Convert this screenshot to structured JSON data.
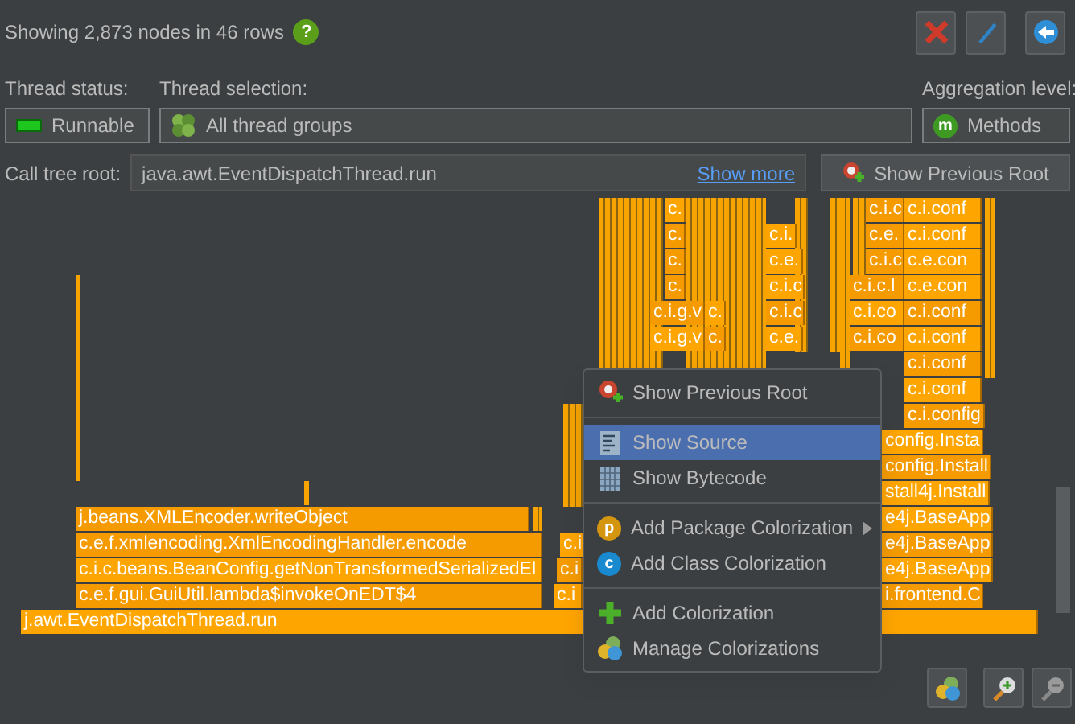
{
  "header": {
    "summary": "Showing 2,873 nodes in 46 rows",
    "help": "?"
  },
  "thread_status": {
    "label": "Thread status:",
    "value": "Runnable"
  },
  "thread_selection": {
    "label": "Thread selection:",
    "value": "All thread groups"
  },
  "aggregation_level": {
    "label": "Aggregation level:",
    "value": "Methods",
    "badge": "m"
  },
  "call_tree_root": {
    "label": "Call tree root:",
    "value": "java.awt.EventDispatchThread.run",
    "link": "Show more",
    "button": "Show Previous Root"
  },
  "flame_graph": {
    "frames": [
      {
        "label": "c."
      },
      {
        "label": "c.i.c"
      },
      {
        "label": "c.i.conf"
      },
      {
        "label": "c."
      },
      {
        "label": "c.i."
      },
      {
        "label": "c.e."
      },
      {
        "label": "c.i.conf"
      },
      {
        "label": "c."
      },
      {
        "label": "c.e."
      },
      {
        "label": "c.i.c"
      },
      {
        "label": "c.e.con"
      },
      {
        "label": "c."
      },
      {
        "label": "c.i.c"
      },
      {
        "label": "c.i.c.l"
      },
      {
        "label": "c.e.con"
      },
      {
        "label": "c.i.g.v"
      },
      {
        "label": "c."
      },
      {
        "label": "c.i.c"
      },
      {
        "label": "c.i.co"
      },
      {
        "label": "c.i.conf"
      },
      {
        "label": "c.i.g.v"
      },
      {
        "label": "c."
      },
      {
        "label": "c.e."
      },
      {
        "label": "c.i.co"
      },
      {
        "label": "c.i.conf"
      },
      {
        "label": "c.i.conf"
      },
      {
        "label": "c.i.conf"
      },
      {
        "label": "c.i.config"
      },
      {
        "label": "config.Insta"
      },
      {
        "label": "config.Install"
      },
      {
        "label": "stall4j.Install"
      },
      {
        "label": "j.beans.XMLEncoder.writeObject"
      },
      {
        "label": "e4j.BaseApp"
      },
      {
        "label": "c.e.f.xmlencoding.XmlEncodingHandler.encode"
      },
      {
        "label": "c.i"
      },
      {
        "label": "e4j.BaseApp"
      },
      {
        "label": "c.i.c.beans.BeanConfig.getNonTransformedSerializedEl"
      },
      {
        "label": "c.i"
      },
      {
        "label": "e4j.BaseApp"
      },
      {
        "label": "c.e.f.gui.GuiUtil.lambda$invokeOnEDT$4"
      },
      {
        "label": "c.i"
      },
      {
        "label": "i.frontend.C"
      },
      {
        "label": "j.awt.EventDispatchThread.run"
      }
    ]
  },
  "context_menu": {
    "groups": [
      [
        {
          "label": "Show Previous Root",
          "selected": false,
          "submenu": false
        }
      ],
      [
        {
          "label": "Show Source",
          "selected": true,
          "submenu": false
        },
        {
          "label": "Show Bytecode",
          "selected": false,
          "submenu": false
        }
      ],
      [
        {
          "label": "Add Package Colorization",
          "badge": "p",
          "selected": false,
          "submenu": true
        },
        {
          "label": "Add Class Colorization",
          "badge": "c",
          "selected": false,
          "submenu": false
        }
      ],
      [
        {
          "label": "Add Colorization",
          "selected": false,
          "submenu": false
        },
        {
          "label": "Manage Colorizations",
          "selected": false,
          "submenu": false
        }
      ]
    ]
  }
}
